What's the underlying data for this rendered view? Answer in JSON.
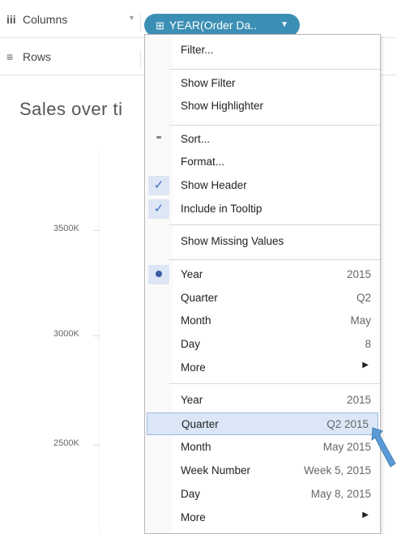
{
  "shelves": {
    "columns": {
      "icon": "iii",
      "label": "Columns"
    },
    "rows": {
      "icon": "≡",
      "label": "Rows"
    },
    "pill": {
      "icon": "⊞",
      "label": "YEAR(Order Da..",
      "color": "#3c8fb4"
    }
  },
  "chart": {
    "title": "Sales over ti",
    "ticks": [
      "3500K",
      "3000K",
      "2500K"
    ]
  },
  "menu": {
    "filter": "Filter...",
    "show_filter": "Show Filter",
    "show_highlighter": "Show Highlighter",
    "sort": "Sort...",
    "format": "Format...",
    "show_header": "Show Header",
    "include_tooltip": "Include in Tooltip",
    "show_missing": "Show Missing Values",
    "discrete": [
      {
        "label": "Year",
        "value": "2015",
        "selected": true
      },
      {
        "label": "Quarter",
        "value": "Q2"
      },
      {
        "label": "Month",
        "value": "May"
      },
      {
        "label": "Day",
        "value": "8"
      },
      {
        "label": "More",
        "value": ""
      }
    ],
    "continuous": [
      {
        "label": "Year",
        "value": "2015"
      },
      {
        "label": "Quarter",
        "value": "Q2 2015",
        "highlighted": true
      },
      {
        "label": "Month",
        "value": "May 2015"
      },
      {
        "label": "Week Number",
        "value": "Week 5, 2015"
      },
      {
        "label": "Day",
        "value": "May 8, 2015"
      },
      {
        "label": "More",
        "value": ""
      }
    ]
  },
  "colors": {
    "accent": "#3c8fb4",
    "highlight": "#dbe7f7",
    "check": "#3a6fc7",
    "pointer": "#5b9bd5"
  }
}
